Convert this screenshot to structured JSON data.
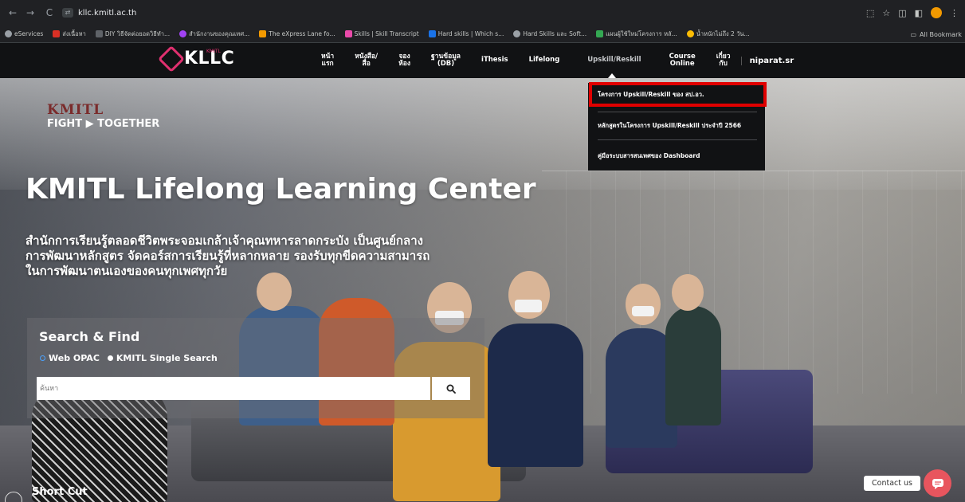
{
  "browser": {
    "url": "kllc.kmitl.ac.th",
    "nav": {
      "back": "←",
      "forward": "→",
      "reload": "C"
    },
    "bookmarks": [
      {
        "label": "eServices",
        "color": "#9aa0a6"
      },
      {
        "label": "ส่งเนื้อหา",
        "color": "#d93025"
      },
      {
        "label": "DIY วิธีจัดต่อยอดวิธีทำ...",
        "color": "#5f6368"
      },
      {
        "label": "สำนักงานของคุณเทศ...",
        "color": "#a142f4"
      },
      {
        "label": "The eXpress Lane fo...",
        "color": "#f29900"
      },
      {
        "label": "Skills | Skill Transcript",
        "color": "#ea4aaa"
      },
      {
        "label": "Hard skills | Which s...",
        "color": "#1a73e8"
      },
      {
        "label": "Hard Skills และ Soft...",
        "color": "#9aa0a6"
      },
      {
        "label": "แผนผู้ใช้ใหม่โครงการ หลั...",
        "color": "#34a853"
      },
      {
        "label": "น้ำหนักไม่ถึง 2 วัน...",
        "color": "#fbbc04"
      }
    ],
    "all_bookmarks": "All Bookmark"
  },
  "site": {
    "logo": "KLLC",
    "logo_sub": "KMITL",
    "menu": [
      {
        "label": "หน้า\nแรก"
      },
      {
        "label": "หนังสือ/\nสื่อ"
      },
      {
        "label": "จอง\nห้อง"
      },
      {
        "label": "ฐานข้อมูล\n(DB)"
      },
      {
        "label": "iThesis"
      },
      {
        "label": "Lifelong"
      },
      {
        "label": "Upskill/Reskill"
      },
      {
        "label": "Course\nOnline"
      },
      {
        "label": "เกี่ยว\nกับ"
      }
    ],
    "user": "niparat.sr",
    "dropdown": [
      "โครงการ Upskill/Reskill ของ สป.อว.",
      "หลักสูตรในโครงการ Upskill/Reskill ประจำปี 2566",
      "คู่มือระบบสารสนเทศของ Dashboard"
    ],
    "highlight_color": "#e00000"
  },
  "hero": {
    "brand_word": "KMITL",
    "brand_tag": "FIGHT ▶ TOGETHER",
    "title": "KMITL Lifelong Learning Center",
    "desc_lines": [
      "สำนักการเรียนรู้ตลอดชีวิตพระจอมเกล้าเจ้าคุณทหารลาดกระบัง เป็นศูนย์กลาง",
      "การพัฒนาหลักสูตร จัดคอร์สการเรียนรู้ที่หลากหลาย รองรับทุกขีดความสามารถ",
      "ในการพัฒนาตนเองของคนทุกเพศทุกวัย"
    ]
  },
  "search": {
    "title": "Search & Find",
    "options": [
      "Web OPAC",
      "KMITL Single Search"
    ],
    "placeholder": "ค้นหา"
  },
  "footer": {
    "shortcut": "Short Cut",
    "contact": "Contact us"
  }
}
